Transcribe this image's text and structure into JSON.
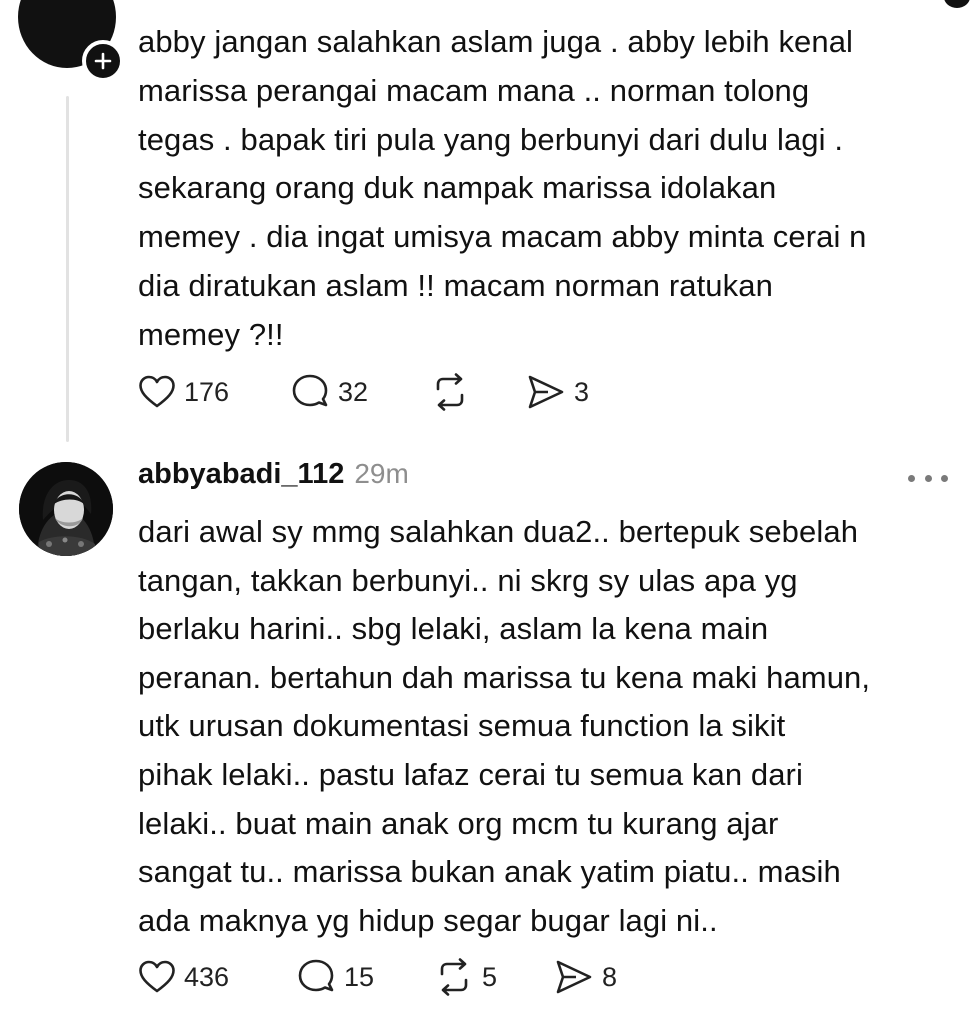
{
  "post_top": {
    "lines": [
      "abby jangan salahkan aslam juga . abby lebih kenal",
      "marissa perangai macam mana .. norman tolong",
      "tegas . bapak tiri pula yang berbunyi dari dulu lagi .",
      "sekarang orang duk nampak marissa idolakan",
      "memey . dia ingat umisya macam abby minta cerai n",
      "dia diratukan aslam !! macam norman ratukan",
      "memey ?!!"
    ],
    "likes": "176",
    "replies": "32",
    "reposts": "",
    "shares": "3"
  },
  "post_reply": {
    "username": "abbyabadi_112",
    "timestamp": "29m",
    "lines": [
      "dari awal sy mmg salahkan dua2.. bertepuk sebelah",
      "tangan, takkan berbunyi.. ni skrg sy ulas apa yg",
      "berlaku harini.. sbg lelaki, aslam la kena main",
      "peranan. bertahun dah marissa tu kena maki hamun,",
      "utk urusan dokumentasi semua function la sikit",
      "pihak lelaki.. pastu lafaz cerai tu semua kan dari",
      "lelaki.. buat main anak org mcm tu kurang ajar",
      "sangat tu.. marissa bukan anak yatim piatu.. masih",
      "ada maknya yg hidup segar bugar lagi ni.."
    ],
    "likes": "436",
    "replies": "15",
    "reposts": "5",
    "shares": "8"
  },
  "icons": {
    "like": "heart-icon",
    "reply": "comment-icon",
    "repost": "repost-icon",
    "share": "send-icon",
    "follow": "plus-icon",
    "more": "more-icon"
  },
  "colors": {
    "text": "#111111",
    "muted": "#8e8e8e",
    "thread_line": "#e2e2e2"
  }
}
